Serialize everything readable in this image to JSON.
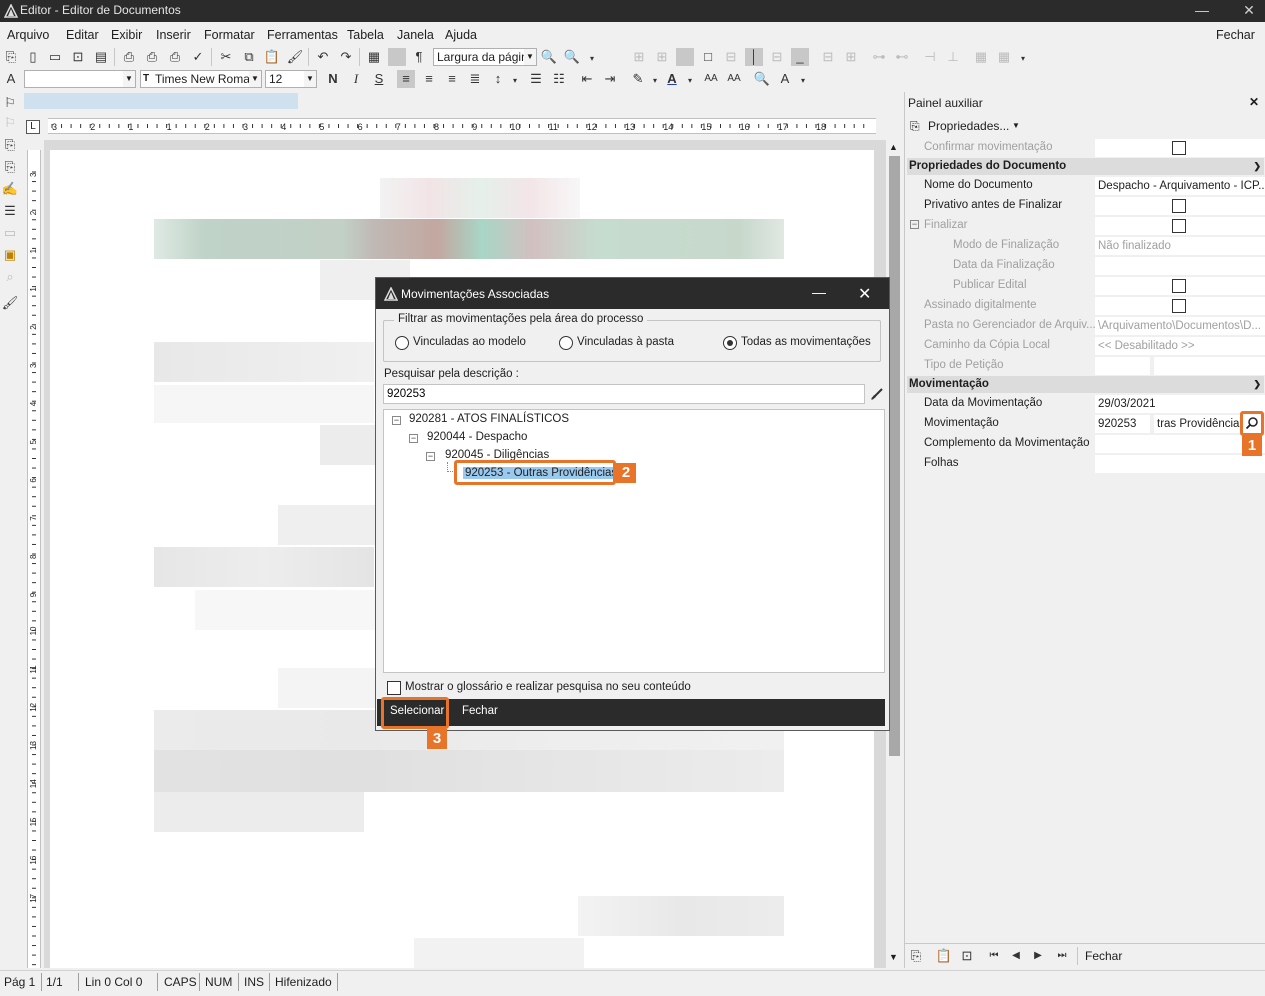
{
  "window": {
    "title": "Editor - Editor de Documentos",
    "minimize_glyph": "—",
    "close_glyph": "✕"
  },
  "menu": {
    "items": [
      {
        "label": "Arquivo"
      },
      {
        "label": "Editar"
      },
      {
        "label": "Exibir"
      },
      {
        "label": "Inserir"
      },
      {
        "label": "Formatar"
      },
      {
        "label": "Ferramentas"
      },
      {
        "label": "Tabela"
      },
      {
        "label": "Janela"
      },
      {
        "label": "Ajuda"
      }
    ],
    "close_label": "Fechar"
  },
  "toolbar": {
    "zoom_value": "Largura da págin",
    "font_name": "Times New Roman",
    "font_size": "12",
    "bold": "N",
    "italic": "I",
    "underline": "S"
  },
  "ruler": {
    "h_labels": [
      "3",
      "2",
      "1",
      "1",
      "2",
      "3",
      "4",
      "5",
      "6",
      "7",
      "8",
      "9",
      "10",
      "11",
      "12",
      "13",
      "14",
      "15",
      "16",
      "17",
      "18"
    ],
    "v_labels": [
      "3",
      "2",
      "1",
      "1",
      "2",
      "3",
      "4",
      "5",
      "6",
      "7",
      "8",
      "9",
      "10",
      "11",
      "12",
      "13",
      "14",
      "15",
      "16",
      "17"
    ]
  },
  "panel": {
    "title": "Painel auxiliar",
    "close_glyph": "✕",
    "properties_label": "Propriedades...",
    "confirm_label": "Confirmar movimentação",
    "doc_props_header": "Propriedades do Documento",
    "rows": {
      "nome_label": "Nome do Documento",
      "nome_value": "Despacho - Arquivamento - ICP...",
      "privativo_label": "Privativo antes de Finalizar",
      "finalizar_label": "Finalizar",
      "modo_label": "Modo de Finalização",
      "modo_value": "Não finalizado",
      "data_final_label": "Data da Finalização",
      "publicar_label": "Publicar Edital",
      "assinado_label": "Assinado digitalmente",
      "pasta_label": "Pasta no Gerenciador de Arquiv...",
      "pasta_value": "\\Arquivamento\\Documentos\\D...",
      "caminho_label": "Caminho da Cópia Local",
      "caminho_value": "<< Desabilitado >>",
      "tipo_label": "Tipo de Petição"
    },
    "mov_header": "Movimentação",
    "mov": {
      "data_label": "Data da Movimentação",
      "data_value": "29/03/2021",
      "mov_label": "Movimentação",
      "mov_code": "920253",
      "mov_desc": "tras Providências",
      "complemento_label": "Complemento da Movimentação",
      "folhas_label": "Folhas"
    },
    "footer_close": "Fechar"
  },
  "dialog": {
    "title": "Movimentações Associadas",
    "minimize_glyph": "—",
    "close_glyph": "✕",
    "filter_legend": "Filtrar as movimentações pela área do processo",
    "radio_modelo": "Vinculadas ao modelo",
    "radio_pasta": "Vinculadas à pasta",
    "radio_todas": "Todas as movimentações",
    "search_label": "Pesquisar pela descrição :",
    "search_value": "920253",
    "tree": [
      {
        "label": "920281 - ATOS FINALÍSTICOS"
      },
      {
        "label": "920044 - Despacho"
      },
      {
        "label": "920045 - Diligências"
      },
      {
        "label": "920253 - Outras Providências"
      }
    ],
    "glossary_label": "Mostrar o glossário e realizar pesquisa no seu conteúdo",
    "select_label": "Selecionar",
    "close_label": "Fechar"
  },
  "callouts": [
    "1",
    "2",
    "3"
  ],
  "status": {
    "page": "Pág 1",
    "pages": "1/1",
    "position": "Lin 0  Col 0",
    "caps": "CAPS",
    "num": "NUM",
    "ins": "INS",
    "hyphen": "Hifenizado"
  },
  "colors": {
    "titlebar": "#2b2b2b",
    "accent_callout": "#e8742a",
    "selection": "#99c9ef"
  },
  "icons": [
    "search-icon",
    "eraser-icon",
    "magnifier-icon"
  ]
}
